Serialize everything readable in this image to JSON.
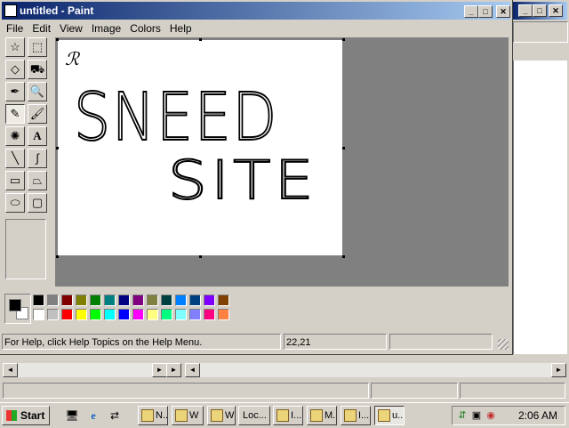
{
  "paint": {
    "title": "untitled - Paint",
    "menu": [
      "File",
      "Edit",
      "View",
      "Image",
      "Colors",
      "Help"
    ],
    "canvas_text": [
      "SNEED",
      "SITE"
    ],
    "canvas_signature": "ℛ",
    "status": {
      "help": "For Help, click Help Topics on the Help Menu.",
      "coords": "22,21",
      "size": ""
    },
    "tools": [
      {
        "name": "free-select",
        "glyph": "☆"
      },
      {
        "name": "rect-select",
        "glyph": "⬚"
      },
      {
        "name": "eraser",
        "glyph": "◇"
      },
      {
        "name": "fill",
        "glyph": "⛟"
      },
      {
        "name": "pick-color",
        "glyph": "✒"
      },
      {
        "name": "magnifier",
        "glyph": "🔍"
      },
      {
        "name": "pencil",
        "glyph": "✎"
      },
      {
        "name": "brush",
        "glyph": "🖌"
      },
      {
        "name": "airbrush",
        "glyph": "✺"
      },
      {
        "name": "text",
        "glyph": "A"
      },
      {
        "name": "line",
        "glyph": "╲"
      },
      {
        "name": "curve",
        "glyph": "∫"
      },
      {
        "name": "rectangle",
        "glyph": "▭"
      },
      {
        "name": "polygon",
        "glyph": "⏢"
      },
      {
        "name": "ellipse",
        "glyph": "⬭"
      },
      {
        "name": "rounded-rect",
        "glyph": "▢"
      }
    ],
    "selected_tool": "pencil",
    "foreground": "#000000",
    "background": "#ffffff",
    "palette_top": [
      "#000000",
      "#808080",
      "#800000",
      "#808000",
      "#008000",
      "#008080",
      "#000080",
      "#800080",
      "#808040",
      "#004040",
      "#0080ff",
      "#004080",
      "#8000ff",
      "#804000"
    ],
    "palette_bottom": [
      "#ffffff",
      "#c0c0c0",
      "#ff0000",
      "#ffff00",
      "#00ff00",
      "#00ffff",
      "#0000ff",
      "#ff00ff",
      "#ffff80",
      "#00ff80",
      "#80ffff",
      "#8080ff",
      "#ff0080",
      "#ff8040"
    ]
  },
  "taskbar": {
    "start_label": "Start",
    "tasks": [
      {
        "label": "N..."
      },
      {
        "label": "W"
      },
      {
        "label": "W"
      },
      {
        "label": "Loc..."
      },
      {
        "label": "I..."
      },
      {
        "label": "M..."
      },
      {
        "label": "I..."
      },
      {
        "label": "u..."
      }
    ],
    "clock": "2:06 AM"
  }
}
